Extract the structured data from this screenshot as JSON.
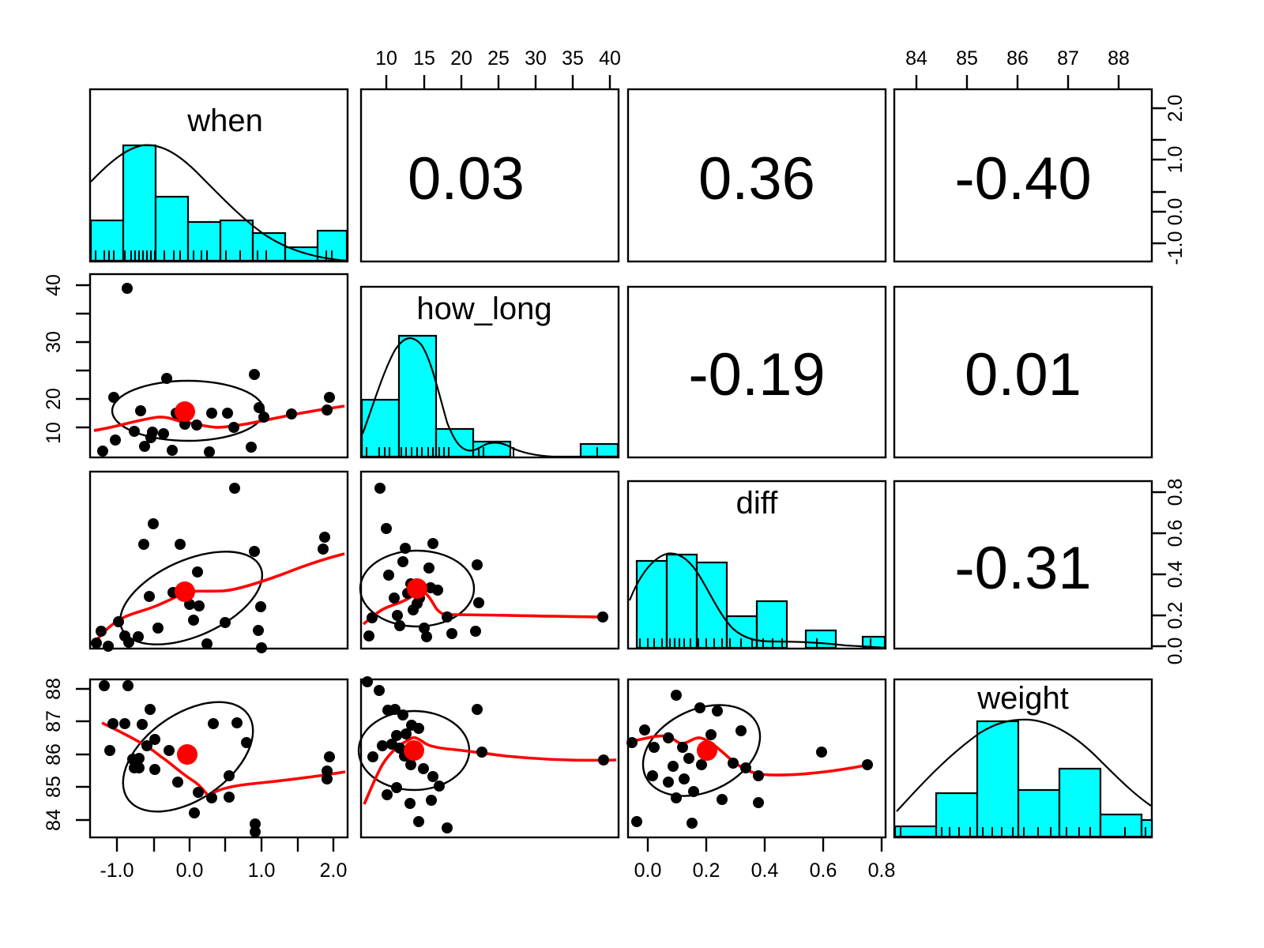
{
  "figure": {
    "type": "scatterplot-matrix",
    "variables": [
      "when",
      "how_long",
      "diff",
      "weight"
    ],
    "n_observations": 28,
    "background": "#ffffff",
    "hist_fill": "#00ffff",
    "accent": "#ff0000"
  },
  "chart_data": {
    "type": "scatter",
    "title": "",
    "subtitle": "",
    "xlabel": "",
    "ylabel": "",
    "grid": false,
    "legend_position": "none",
    "matrix": {
      "rows": [
        "when",
        "how_long",
        "diff",
        "weight"
      ],
      "cols": [
        "when",
        "how_long",
        "diff",
        "weight"
      ],
      "diagonal": "histogram-with-density-and-rug",
      "lower_triangle": "scatter-with-loess-and-confidence-ellipse",
      "upper_triangle": "pearson-correlation"
    },
    "correlations": [
      {
        "x": "when",
        "y": "how_long",
        "r": "0.03"
      },
      {
        "x": "when",
        "y": "diff",
        "r": "0.36"
      },
      {
        "x": "when",
        "y": "weight",
        "r": "-0.40"
      },
      {
        "x": "how_long",
        "y": "diff",
        "r": "-0.19"
      },
      {
        "x": "how_long",
        "y": "weight",
        "r": "0.01"
      },
      {
        "x": "diff",
        "y": "weight",
        "r": "-0.31"
      }
    ],
    "axes": {
      "when": {
        "ticks": [
          "-1.0",
          "0.0",
          "1.0",
          "2.0"
        ],
        "range": [
          -1.45,
          2.35
        ],
        "side": "bottom-left"
      },
      "how_long": {
        "ticks": [
          "10",
          "15",
          "20",
          "25",
          "30",
          "35",
          "40"
        ],
        "range": [
          5.2,
          41.5
        ],
        "side": "top-left"
      },
      "diff": {
        "ticks": [
          "0.0",
          "0.2",
          "0.4",
          "0.6",
          "0.8"
        ],
        "range": [
          -0.06,
          0.89
        ],
        "side": "bottom-right"
      },
      "weight": {
        "ticks": [
          "84",
          "85",
          "86",
          "87",
          "88"
        ],
        "range": [
          83.5,
          88.7
        ],
        "side": "top-right"
      },
      "row1_right_ticks": [
        "-1.0",
        "0.0",
        "1.0",
        "2.0"
      ],
      "row3_right_ticks": [
        "0.0",
        "0.2",
        "0.4",
        "0.6",
        "0.8"
      ],
      "row2_left_ticks": [
        "10",
        "20",
        "30",
        "40"
      ],
      "row4_left_ticks": [
        "84",
        "85",
        "86",
        "87",
        "88"
      ]
    },
    "histograms": {
      "when": {
        "bins": 8,
        "counts": [
          3,
          9,
          5,
          3,
          3,
          2,
          1,
          2
        ],
        "bin_edges": [
          -1.5,
          -1.0,
          -0.5,
          0.0,
          0.5,
          1.0,
          1.5,
          2.0,
          2.5
        ],
        "density_curve": true,
        "rug": true
      },
      "how_long": {
        "bins": 7,
        "counts": [
          6,
          11,
          4,
          2,
          0,
          0,
          1
        ],
        "bin_edges": [
          5,
          10,
          15,
          20,
          25,
          30,
          35,
          40
        ],
        "density_curve": true,
        "rug": true
      },
      "diff": {
        "bins": 8,
        "counts": [
          6,
          8,
          6,
          2,
          4,
          0,
          1,
          1
        ],
        "bin_edges": [
          0.0,
          0.1,
          0.2,
          0.3,
          0.4,
          0.5,
          0.6,
          0.7,
          0.8
        ],
        "density_curve": true,
        "rug": true
      },
      "weight": {
        "bins": 6,
        "counts": [
          1,
          5,
          9,
          4,
          6,
          3
        ],
        "bin_edges": [
          83.5,
          84.5,
          85.5,
          86.5,
          87.5,
          88.5,
          89.0
        ],
        "density_curve": true,
        "rug": true
      }
    },
    "points": {
      "when": [
        -1.3,
        -1.1,
        -0.95,
        -0.92,
        -0.88,
        -0.8,
        -0.75,
        -0.7,
        -0.68,
        -0.6,
        -0.55,
        -0.5,
        -0.42,
        -0.35,
        -0.3,
        -0.2,
        -0.15,
        -0.05,
        0.1,
        0.22,
        0.3,
        0.45,
        0.62,
        0.95,
        0.98,
        1.02,
        2.02,
        2.08
      ],
      "how_long": [
        6.0,
        10.0,
        13.5,
        8.0,
        8.2,
        11.0,
        10.8,
        14.0,
        15.5,
        13.3,
        12.8,
        11.5,
        14.5,
        15.2,
        13.8,
        13.5,
        22.5,
        38.8,
        12.5,
        6.0,
        14.0,
        13.5,
        10.8,
        8.0,
        13.0,
        22.0,
        14.0,
        15.5
      ],
      "diff": [
        0.02,
        0.05,
        0.1,
        0.03,
        0.04,
        0.12,
        0.08,
        0.18,
        0.3,
        0.22,
        0.2,
        0.15,
        0.43,
        0.36,
        0.25,
        0.2,
        0.55,
        0.7,
        0.13,
        0.03,
        0.26,
        0.17,
        0.1,
        0.05,
        0.3,
        0.47,
        0.37,
        0.32
      ],
      "weight": [
        88.6,
        85.9,
        87.3,
        87.3,
        85.9,
        85.7,
        85.7,
        88.6,
        87.3,
        87.8,
        86.9,
        86.7,
        86.4,
        85.4,
        84.7,
        84.8,
        87.3,
        86.4,
        84.7,
        84.2,
        85.4,
        86.4,
        85.4,
        83.9,
        83.8,
        87.3,
        85.8,
        85.5
      ]
    },
    "annotations": {
      "center_marker": "red filled circle at bivariate mean",
      "ellipse": "black confidence ellipse",
      "smoother": "red loess line"
    }
  }
}
